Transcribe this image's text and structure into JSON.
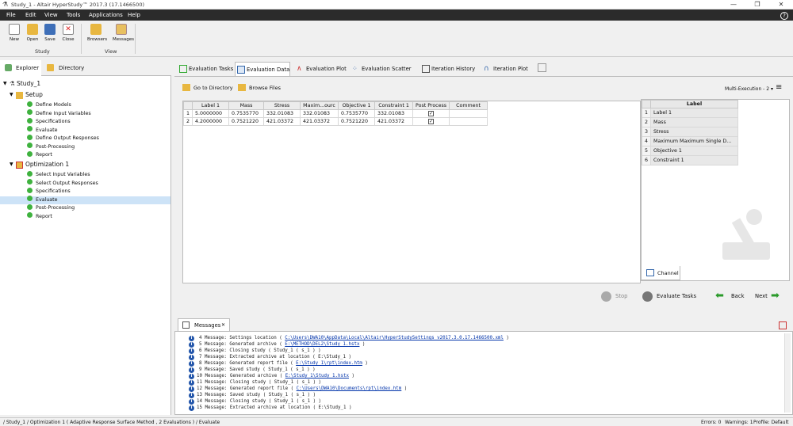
{
  "window": {
    "title": "Study_1 - Altair HyperStudy™ 2017.3 (17.1466500)",
    "minimize": "—",
    "maximize": "❐",
    "close": "✕"
  },
  "menu": [
    "File",
    "Edit",
    "View",
    "Tools",
    "Applications",
    "Help"
  ],
  "menu_help": "?",
  "toolbar": {
    "study_buttons": [
      "New",
      "Open",
      "Save",
      "Close"
    ],
    "study_group": "Study",
    "view_buttons": [
      "Browsers",
      "Messages"
    ],
    "view_group": "View"
  },
  "left_tabs": [
    "Explorer",
    "Directory"
  ],
  "tree": {
    "root": "Study_1",
    "setup": "Setup",
    "setup_items": [
      "Define Models",
      "Define Input Variables",
      "Specifications",
      "Evaluate",
      "Define Output Responses",
      "Post-Processing",
      "Report"
    ],
    "optimization": "Optimization 1",
    "optimization_items": [
      "Select Input Variables",
      "Select Output Responses",
      "Specifications",
      "Evaluate",
      "Post-Processing",
      "Report"
    ]
  },
  "right_tabs": [
    "Evaluation Tasks",
    "Evaluation Data",
    "Evaluation Plot",
    "Evaluation Scatter",
    "Iteration History",
    "Iteration Plot"
  ],
  "subtoolbar": {
    "goto": "Go to Directory",
    "browse": "Browse Files",
    "mode": "Multi-Execution - 2"
  },
  "grid": {
    "columns": [
      "Label 1",
      "Mass",
      "Stress",
      "Maximum Maximum Source",
      "Objective 1",
      "Constraint 1",
      "Post Process",
      "Comment"
    ],
    "column_display": [
      "Label 1",
      "Mass",
      "Stress",
      "Maxim...ourc",
      "Objective 1",
      "Constraint 1",
      "Post Process",
      "Comment"
    ],
    "rows": [
      {
        "n": "1",
        "cells": [
          "5.0000000",
          "0.7535770",
          "332.01083",
          "332.01083",
          "0.7535770",
          "332.01083"
        ],
        "post": true,
        "comment": ""
      },
      {
        "n": "2",
        "cells": [
          "4.2000000",
          "0.7521220",
          "421.03372",
          "421.03372",
          "0.7521220",
          "421.03372"
        ],
        "post": true,
        "comment": ""
      }
    ]
  },
  "channel": {
    "header": "Label",
    "rows": [
      {
        "n": "1",
        "label": "Label 1"
      },
      {
        "n": "2",
        "label": "Mass"
      },
      {
        "n": "3",
        "label": "Stress"
      },
      {
        "n": "4",
        "label": "Maximum Maximum Single D..."
      },
      {
        "n": "5",
        "label": "Objective 1"
      },
      {
        "n": "6",
        "label": "Constraint 1"
      }
    ],
    "tab": "Channel"
  },
  "actions": {
    "stop": "Stop",
    "evaluate": "Evaluate Tasks",
    "back": "Back",
    "next": "Next"
  },
  "messages": {
    "tab": "Messages",
    "lines": [
      {
        "pre": "4 Message: Settings location ( ",
        "link": "C:\\Users\\DWA10\\AppData\\Local\\Altair\\HyperStudySettings_v2017.3.0.17.1466500.xml",
        "post": " )"
      },
      {
        "pre": "5 Message: Generated archive ( ",
        "link": "E:\\METHOD\\DEL2\\Study_1.hstx",
        "post": " )"
      },
      {
        "pre": "6 Message: Closing study ( Study_1 ( s_1 ) )",
        "link": "",
        "post": ""
      },
      {
        "pre": "7 Message: Extracted archive at location ( E:\\Study_1 )",
        "link": "",
        "post": ""
      },
      {
        "pre": "8 Message: Generated report file ( ",
        "link": "E:\\Study_1\\rpt\\index.htm",
        "post": " )"
      },
      {
        "pre": "9 Message: Saved study ( Study_1 ( s_1 ) )",
        "link": "",
        "post": ""
      },
      {
        "pre": "10 Message: Generated archive ( ",
        "link": "E:\\Study_1\\Study_1.hstx",
        "post": " )"
      },
      {
        "pre": "11 Message: Closing study ( Study_1 ( s_1 ) )",
        "link": "",
        "post": ""
      },
      {
        "pre": "12 Message: Generated report file ( ",
        "link": "C:\\Users\\DWA10\\Documents\\rpt\\index.htm",
        "post": " )"
      },
      {
        "pre": "13 Message: Saved study ( Study_1 ( s_1 ) )",
        "link": "",
        "post": ""
      },
      {
        "pre": "14 Message: Closing study ( Study_1 ( s_1 ) )",
        "link": "",
        "post": ""
      },
      {
        "pre": "15 Message: Extracted archive at location ( E:\\Study_1 )",
        "link": "",
        "post": ""
      }
    ]
  },
  "status": {
    "path": "/ Study_1 / Optimization 1 ( Adaptive Response Surface Method , 2 Evaluations ) / Evaluate",
    "errors": "Errors: 0",
    "warnings": "Warnings: 1",
    "profile": "Profile: Default"
  },
  "colors": {
    "menubar": "#2b2b2b",
    "check_green": "#3fb23f",
    "selection": "#cde3f7",
    "link": "#0033aa"
  }
}
